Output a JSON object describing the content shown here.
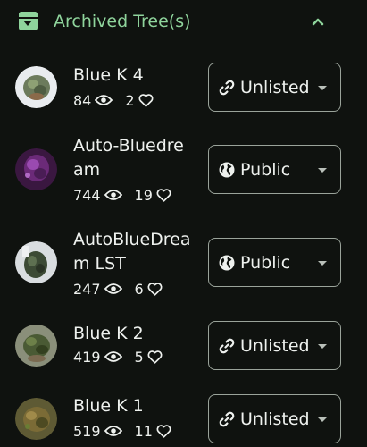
{
  "section": {
    "title": "Archived Tree(s)",
    "header_icon": "archive-icon",
    "collapse_icon": "chevron-up-icon",
    "accent_color": "#8fd49c"
  },
  "trees": [
    {
      "name": "Blue K 4",
      "views": "84",
      "likes": "2",
      "visibility": "Unlisted",
      "visibility_icon": "link-icon"
    },
    {
      "name": "Auto-Bluedream",
      "views": "744",
      "likes": "19",
      "visibility": "Public",
      "visibility_icon": "globe-icon"
    },
    {
      "name": "AutoBlueDream LST",
      "views": "247",
      "likes": "6",
      "visibility": "Public",
      "visibility_icon": "globe-icon"
    },
    {
      "name": "Blue K 2",
      "views": "419",
      "likes": "5",
      "visibility": "Unlisted",
      "visibility_icon": "link-icon"
    },
    {
      "name": "Blue K 1",
      "views": "519",
      "likes": "11",
      "visibility": "Unlisted",
      "visibility_icon": "link-icon"
    }
  ]
}
